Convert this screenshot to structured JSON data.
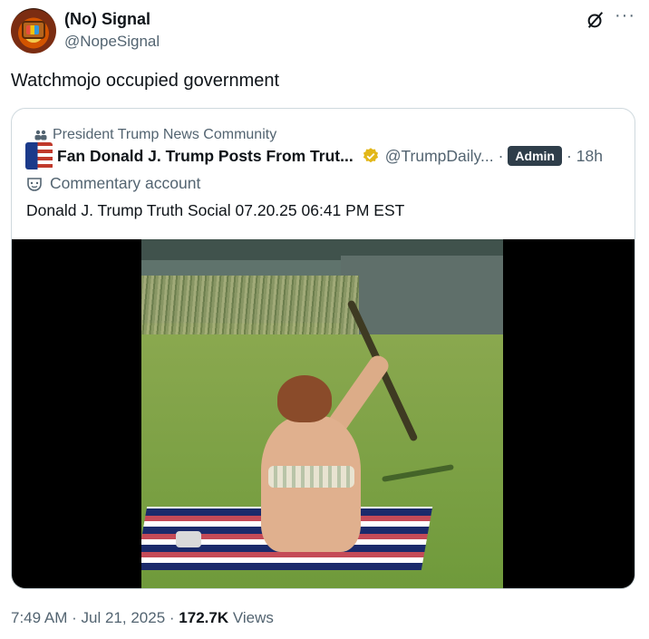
{
  "author": {
    "name": "(No) Signal",
    "handle": "@NopeSignal"
  },
  "tweet": {
    "text": "Watchmojo occupied government"
  },
  "quoted": {
    "community": "President Trump News Community",
    "name": "Fan Donald J. Trump Posts From Trut...",
    "handle": "@TrumpDaily...",
    "separator": "·",
    "badge": "Admin",
    "time": "18h",
    "label": "Commentary account",
    "text": "Donald J. Trump Truth Social 07.20.25 06:41 PM EST"
  },
  "meta": {
    "time": "7:49 AM",
    "date": "Jul 21, 2025",
    "separator": "·",
    "views_count": "172.7K",
    "views_label": "Views"
  },
  "icons": {
    "grok": "grok-icon",
    "more": "more-icon",
    "community": "community-icon",
    "verified": "verified-gold-badge-icon",
    "commentary": "mask-icon"
  },
  "colors": {
    "text": "#0f1419",
    "secondary": "#536471",
    "border": "#cfd9de",
    "verified_gold": "#e2b719",
    "admin_badge": "#2f3e4a"
  }
}
